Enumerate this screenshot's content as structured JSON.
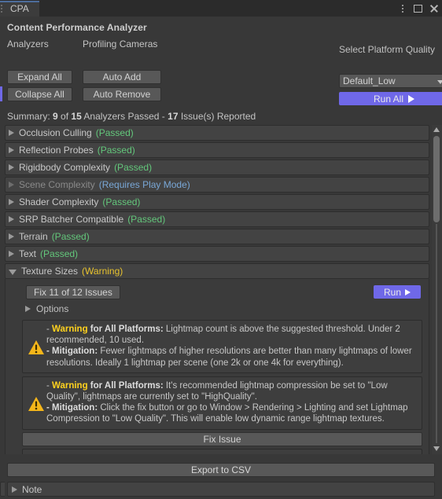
{
  "window": {
    "tab_label": "CPA",
    "controls": {
      "kebab": "more-options",
      "maximize": "maximize",
      "close": "close"
    }
  },
  "header": {
    "title": "Content Performance Analyzer",
    "analyzers_label": "Analyzers",
    "cameras_label": "Profiling Cameras",
    "expand_all": "Expand All",
    "collapse_all": "Collapse All",
    "auto_add": "Auto Add",
    "auto_remove": "Auto Remove",
    "quality_label": "Select Platform Quality",
    "quality_value": "Default_Low",
    "run_all": "Run All"
  },
  "summary": {
    "prefix": "Summary: ",
    "passed_count": "9",
    "mid": " of ",
    "total_count": "15",
    "mid2": " Analyzers Passed - ",
    "issue_count": "17",
    "suffix": " Issue(s) Reported"
  },
  "analyzers": [
    {
      "name": "Occlusion Culling",
      "status": "(Passed)",
      "state": "pass",
      "expanded": false
    },
    {
      "name": "Reflection Probes",
      "status": "(Passed)",
      "state": "pass",
      "expanded": false
    },
    {
      "name": "Rigidbody Complexity",
      "status": "(Passed)",
      "state": "pass",
      "expanded": false
    },
    {
      "name": "Scene Complexity",
      "status": "(Requires Play Mode)",
      "state": "playmode",
      "expanded": false
    },
    {
      "name": "Shader Complexity",
      "status": "(Passed)",
      "state": "pass",
      "expanded": false
    },
    {
      "name": "SRP Batcher Compatible",
      "status": "(Passed)",
      "state": "pass",
      "expanded": false
    },
    {
      "name": "Terrain",
      "status": "(Passed)",
      "state": "pass",
      "expanded": false
    },
    {
      "name": "Text",
      "status": "(Passed)",
      "state": "pass",
      "expanded": false
    },
    {
      "name": "Texture Sizes",
      "status": "(Warning)",
      "state": "warn",
      "expanded": true
    }
  ],
  "texture_sizes_panel": {
    "fix_all_label": "Fix 11 of 12 Issues",
    "run_label": "Run",
    "options_label": "Options",
    "issues": [
      {
        "icon": "warning-icon",
        "warning_word": "Warning",
        "platform_text": " for All Platforms:",
        "message": " Lightmap count is above the suggested threshold. Under 2 recommended, 10 used.",
        "mitigation_word": "- Mitigation:",
        "mitigation_text": " Fewer lightmaps of higher resolutions are better than many lightmaps of lower resolutions. Ideally 1 lightmap per scene (one 2k or one 4k for everything)."
      },
      {
        "icon": "warning-icon",
        "warning_word": "Warning",
        "platform_text": " for All Platforms:",
        "message": " It's recommended lightmap compression be set to \"Low Quality\", lightmaps are currently set to \"HighQuality\".",
        "mitigation_word": "- Mitigation:",
        "mitigation_text": " Click the fix button or go to Window > Rendering > Lighting and set Lightmap Compression to \"Low Quality\". This will enable low dynamic range lightmap textures.",
        "fix_label": "Fix Issue"
      }
    ]
  },
  "footer": {
    "export_label": "Export to CSV",
    "note_label": "Note"
  },
  "colors": {
    "accent_blue": "#6f68e8",
    "pass_green": "#63c77b",
    "warn_yellow": "#e8c32e",
    "playmode_blue": "#79a7d6",
    "panel_bg": "#383838",
    "row_bg": "#434343",
    "button_bg": "#585858",
    "tab_accent": "#4d6d9c"
  }
}
